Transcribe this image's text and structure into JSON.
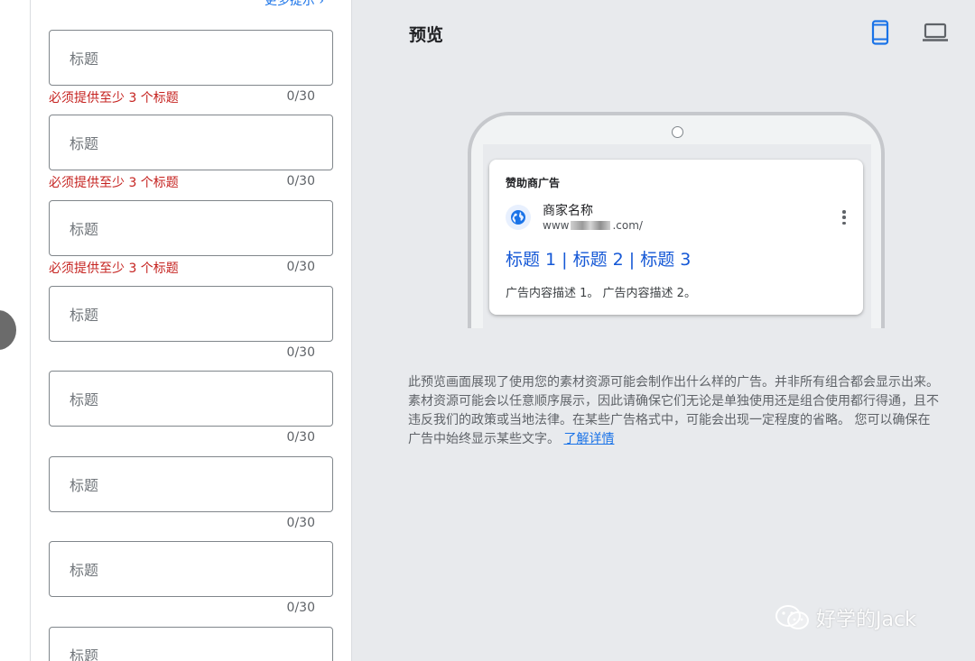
{
  "form": {
    "more_tips_label": "更多提示",
    "fields": [
      {
        "placeholder": "标题",
        "error": "必须提供至少 3 个标题",
        "counter": "0/30"
      },
      {
        "placeholder": "标题",
        "error": "必须提供至少 3 个标题",
        "counter": "0/30"
      },
      {
        "placeholder": "标题",
        "error": "必须提供至少 3 个标题",
        "counter": "0/30"
      },
      {
        "placeholder": "标题",
        "error": "",
        "counter": "0/30"
      },
      {
        "placeholder": "标题",
        "error": "",
        "counter": "0/30"
      },
      {
        "placeholder": "标题",
        "error": "",
        "counter": "0/30"
      },
      {
        "placeholder": "标题",
        "error": "",
        "counter": "0/30"
      },
      {
        "placeholder": "标题",
        "error": "",
        "counter": ""
      }
    ]
  },
  "preview": {
    "title": "预览",
    "device_icons": [
      "smartphone-icon",
      "laptop-icon"
    ],
    "active_device": "smartphone-icon",
    "ad": {
      "sponsored_label": "赞助商广告",
      "business_name": "商家名称",
      "url_prefix": "www",
      "url_suffix": ".com/",
      "headline": "标题 1 | 标题 2 | 标题 3",
      "description": "广告内容描述 1。 广告内容描述 2。"
    },
    "note": "此预览画面展现了使用您的素材资源可能会制作出什么样的广告。并非所有组合都会显示出来。素材资源可能会以任意顺序展示，因此请确保它们无论是单独使用还是组合使用都行得通，且不违反我们的政策或当地法律。在某些广告格式中，可能会出现一定程度的省略。 您可以确保在广告中始终显示某些文字。",
    "learn_more_label": "了解详情"
  },
  "watermark": {
    "text": "好学的Jack"
  },
  "colors": {
    "error": "#c5221f",
    "link": "#1a73e8",
    "headline": "#1558d6",
    "background": "#e8eaed"
  }
}
